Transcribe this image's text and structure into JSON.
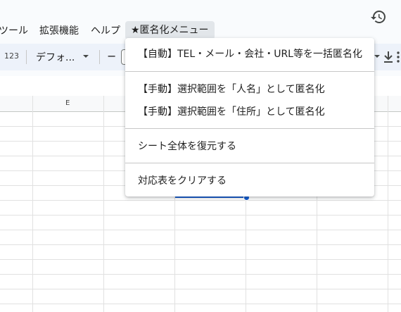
{
  "menubar": {
    "items": [
      {
        "label": "ツール"
      },
      {
        "label": "拡張機能"
      },
      {
        "label": "ヘルプ"
      },
      {
        "label": "★匿名化メニュー"
      }
    ]
  },
  "toolbar": {
    "number_format": "123",
    "font_name": "デフォ...",
    "decrease_size": "−"
  },
  "sheet": {
    "column_label": "E"
  },
  "anonymize_menu": {
    "items": [
      {
        "label": "【自動】TEL・メール・会社・URL等を一括匿名化"
      },
      {
        "label": "【手動】選択範囲を「人名」として匿名化"
      },
      {
        "label": "【手動】選択範囲を「住所」として匿名化"
      },
      {
        "label": "シート全体を復元する"
      },
      {
        "label": "対応表をクリアする"
      }
    ]
  }
}
